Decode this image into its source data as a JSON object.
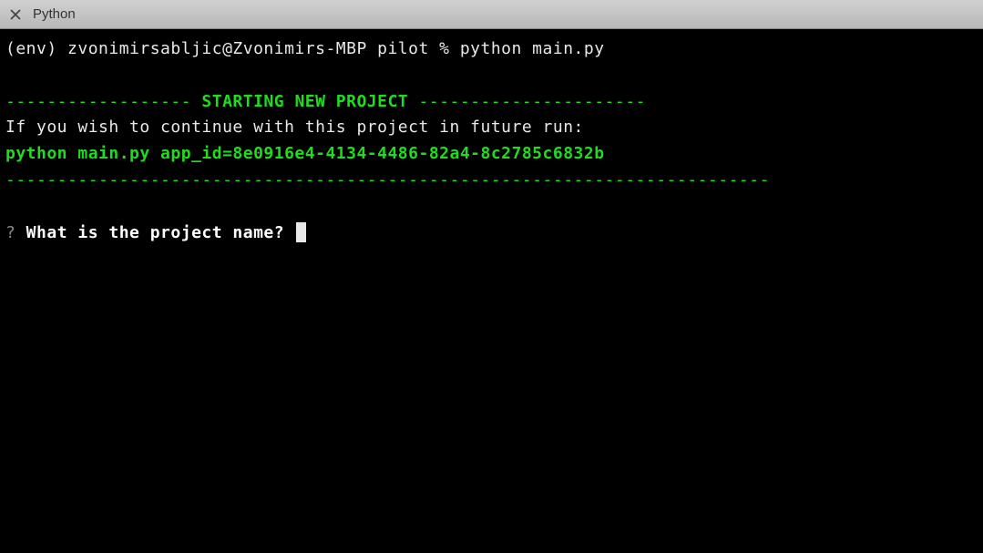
{
  "window": {
    "title": "Python"
  },
  "terminal": {
    "prompt_line": "(env) zvonimirsabljic@Zvonimirs-MBP pilot % python main.py",
    "header_left": "------------------ ",
    "header_title": "STARTING NEW PROJECT",
    "header_right": " ----------------------",
    "continue_msg": "If you wish to continue with this project in future run:",
    "continue_cmd": "python main.py app_id=8e0916e4-4134-4486-82a4-8c2785c6832b",
    "divider": "--------------------------------------------------------------------------",
    "question_mark": "?",
    "question_text": " What is the project name? "
  }
}
